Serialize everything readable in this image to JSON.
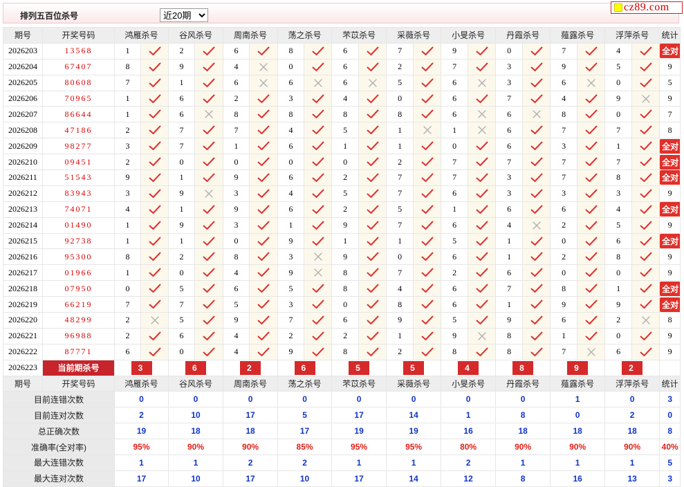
{
  "title": "排列五百位杀号",
  "period_select": {
    "value": "近20期",
    "options": [
      "近20期"
    ]
  },
  "logo": "cz89.com",
  "headers": [
    "期号",
    "开奖号码",
    "鸿雁杀号",
    "谷风杀号",
    "周南杀号",
    "荡之杀号",
    "芣苡杀号",
    "采薇杀号",
    "小旻杀号",
    "丹霞杀号",
    "薤露杀号",
    "浮萍杀号",
    "统计"
  ],
  "rows": [
    {
      "issue": "2026203",
      "draw": "13568",
      "kills": [
        [
          1,
          1
        ],
        [
          2,
          1
        ],
        [
          6,
          1
        ],
        [
          8,
          1
        ],
        [
          6,
          1
        ],
        [
          7,
          1
        ],
        [
          9,
          1
        ],
        [
          0,
          1
        ],
        [
          7,
          1
        ],
        [
          4,
          1
        ]
      ],
      "stat": "全对"
    },
    {
      "issue": "2026204",
      "draw": "67407",
      "kills": [
        [
          8,
          1
        ],
        [
          9,
          1
        ],
        [
          4,
          0
        ],
        [
          0,
          1
        ],
        [
          6,
          1
        ],
        [
          2,
          1
        ],
        [
          7,
          1
        ],
        [
          3,
          1
        ],
        [
          9,
          1
        ],
        [
          5,
          1
        ]
      ],
      "stat": "9"
    },
    {
      "issue": "2026205",
      "draw": "80608",
      "kills": [
        [
          7,
          1
        ],
        [
          1,
          1
        ],
        [
          6,
          0
        ],
        [
          6,
          0
        ],
        [
          6,
          0
        ],
        [
          5,
          1
        ],
        [
          6,
          0
        ],
        [
          3,
          1
        ],
        [
          6,
          0
        ],
        [
          0,
          1
        ]
      ],
      "stat": "5"
    },
    {
      "issue": "2026206",
      "draw": "70965",
      "kills": [
        [
          1,
          1
        ],
        [
          6,
          1
        ],
        [
          2,
          1
        ],
        [
          3,
          1
        ],
        [
          4,
          1
        ],
        [
          0,
          1
        ],
        [
          6,
          1
        ],
        [
          7,
          1
        ],
        [
          4,
          1
        ],
        [
          9,
          0
        ]
      ],
      "stat": "9"
    },
    {
      "issue": "2026207",
      "draw": "86644",
      "kills": [
        [
          1,
          1
        ],
        [
          6,
          0
        ],
        [
          8,
          1
        ],
        [
          8,
          1
        ],
        [
          8,
          1
        ],
        [
          8,
          1
        ],
        [
          6,
          0
        ],
        [
          6,
          0
        ],
        [
          8,
          1
        ],
        [
          0,
          1
        ]
      ],
      "stat": "7"
    },
    {
      "issue": "2026208",
      "draw": "47186",
      "kills": [
        [
          2,
          1
        ],
        [
          7,
          1
        ],
        [
          7,
          1
        ],
        [
          4,
          1
        ],
        [
          5,
          1
        ],
        [
          1,
          0
        ],
        [
          1,
          0
        ],
        [
          6,
          1
        ],
        [
          7,
          1
        ],
        [
          7,
          1
        ]
      ],
      "stat": "8"
    },
    {
      "issue": "2026209",
      "draw": "98277",
      "kills": [
        [
          3,
          1
        ],
        [
          7,
          1
        ],
        [
          1,
          1
        ],
        [
          6,
          1
        ],
        [
          1,
          1
        ],
        [
          1,
          1
        ],
        [
          0,
          1
        ],
        [
          6,
          1
        ],
        [
          3,
          1
        ],
        [
          1,
          1
        ]
      ],
      "stat": "全对"
    },
    {
      "issue": "2026210",
      "draw": "09451",
      "kills": [
        [
          2,
          1
        ],
        [
          0,
          1
        ],
        [
          0,
          1
        ],
        [
          0,
          1
        ],
        [
          0,
          1
        ],
        [
          2,
          1
        ],
        [
          7,
          1
        ],
        [
          7,
          1
        ],
        [
          7,
          1
        ],
        [
          7,
          1
        ]
      ],
      "stat": "全对"
    },
    {
      "issue": "2026211",
      "draw": "51543",
      "kills": [
        [
          9,
          1
        ],
        [
          1,
          1
        ],
        [
          9,
          1
        ],
        [
          6,
          1
        ],
        [
          2,
          1
        ],
        [
          7,
          1
        ],
        [
          7,
          1
        ],
        [
          3,
          1
        ],
        [
          7,
          1
        ],
        [
          8,
          1
        ]
      ],
      "stat": "全对"
    },
    {
      "issue": "2026212",
      "draw": "83943",
      "kills": [
        [
          3,
          1
        ],
        [
          9,
          0
        ],
        [
          3,
          1
        ],
        [
          4,
          1
        ],
        [
          5,
          1
        ],
        [
          7,
          1
        ],
        [
          6,
          1
        ],
        [
          3,
          1
        ],
        [
          3,
          1
        ],
        [
          3,
          1
        ]
      ],
      "stat": "9"
    },
    {
      "issue": "2026213",
      "draw": "74071",
      "kills": [
        [
          4,
          1
        ],
        [
          1,
          1
        ],
        [
          9,
          1
        ],
        [
          6,
          1
        ],
        [
          2,
          1
        ],
        [
          5,
          1
        ],
        [
          1,
          1
        ],
        [
          6,
          1
        ],
        [
          6,
          1
        ],
        [
          4,
          1
        ]
      ],
      "stat": "全对"
    },
    {
      "issue": "2026214",
      "draw": "01490",
      "kills": [
        [
          1,
          1
        ],
        [
          9,
          1
        ],
        [
          3,
          1
        ],
        [
          1,
          1
        ],
        [
          9,
          1
        ],
        [
          7,
          1
        ],
        [
          6,
          1
        ],
        [
          4,
          0
        ],
        [
          2,
          1
        ],
        [
          5,
          1
        ]
      ],
      "stat": "9"
    },
    {
      "issue": "2026215",
      "draw": "92738",
      "kills": [
        [
          1,
          1
        ],
        [
          1,
          1
        ],
        [
          0,
          1
        ],
        [
          9,
          1
        ],
        [
          1,
          1
        ],
        [
          1,
          1
        ],
        [
          5,
          1
        ],
        [
          1,
          1
        ],
        [
          0,
          1
        ],
        [
          6,
          1
        ]
      ],
      "stat": "全对"
    },
    {
      "issue": "2026216",
      "draw": "95300",
      "kills": [
        [
          8,
          1
        ],
        [
          2,
          1
        ],
        [
          8,
          1
        ],
        [
          3,
          0
        ],
        [
          9,
          1
        ],
        [
          0,
          1
        ],
        [
          6,
          1
        ],
        [
          1,
          1
        ],
        [
          2,
          1
        ],
        [
          8,
          1
        ]
      ],
      "stat": "9"
    },
    {
      "issue": "2026217",
      "draw": "01966",
      "kills": [
        [
          1,
          1
        ],
        [
          0,
          1
        ],
        [
          4,
          1
        ],
        [
          9,
          0
        ],
        [
          8,
          1
        ],
        [
          7,
          1
        ],
        [
          2,
          1
        ],
        [
          6,
          1
        ],
        [
          0,
          1
        ],
        [
          0,
          1
        ]
      ],
      "stat": "9"
    },
    {
      "issue": "2026218",
      "draw": "07950",
      "kills": [
        [
          0,
          1
        ],
        [
          5,
          1
        ],
        [
          6,
          1
        ],
        [
          5,
          1
        ],
        [
          8,
          1
        ],
        [
          4,
          1
        ],
        [
          6,
          1
        ],
        [
          7,
          1
        ],
        [
          8,
          1
        ],
        [
          1,
          1
        ]
      ],
      "stat": "全对"
    },
    {
      "issue": "2026219",
      "draw": "66219",
      "kills": [
        [
          7,
          1
        ],
        [
          7,
          1
        ],
        [
          5,
          1
        ],
        [
          3,
          1
        ],
        [
          0,
          1
        ],
        [
          8,
          1
        ],
        [
          6,
          1
        ],
        [
          1,
          1
        ],
        [
          9,
          1
        ],
        [
          9,
          1
        ]
      ],
      "stat": "全对"
    },
    {
      "issue": "2026220",
      "draw": "48299",
      "kills": [
        [
          2,
          0
        ],
        [
          5,
          1
        ],
        [
          9,
          1
        ],
        [
          7,
          1
        ],
        [
          6,
          1
        ],
        [
          9,
          1
        ],
        [
          5,
          1
        ],
        [
          9,
          1
        ],
        [
          6,
          1
        ],
        [
          2,
          0
        ]
      ],
      "stat": "8"
    },
    {
      "issue": "2026221",
      "draw": "96988",
      "kills": [
        [
          2,
          1
        ],
        [
          6,
          1
        ],
        [
          4,
          1
        ],
        [
          2,
          1
        ],
        [
          2,
          1
        ],
        [
          1,
          1
        ],
        [
          9,
          0
        ],
        [
          8,
          1
        ],
        [
          1,
          1
        ],
        [
          0,
          1
        ]
      ],
      "stat": "9"
    },
    {
      "issue": "2026222",
      "draw": "87771",
      "kills": [
        [
          6,
          1
        ],
        [
          0,
          1
        ],
        [
          4,
          1
        ],
        [
          9,
          1
        ],
        [
          8,
          1
        ],
        [
          2,
          1
        ],
        [
          8,
          1
        ],
        [
          8,
          1
        ],
        [
          7,
          0
        ],
        [
          6,
          1
        ]
      ],
      "stat": "9"
    }
  ],
  "current": {
    "issue": "2026223",
    "label": "当前期杀号",
    "kills": [
      "3",
      "6",
      "2",
      "6",
      "5",
      "5",
      "4",
      "8",
      "9",
      "2"
    ]
  },
  "summary": [
    {
      "label": "目前连错次数",
      "values": [
        "0",
        "0",
        "0",
        "0",
        "0",
        "0",
        "0",
        "0",
        "1",
        "0",
        "3"
      ]
    },
    {
      "label": "目前连对次数",
      "values": [
        "2",
        "10",
        "17",
        "5",
        "17",
        "14",
        "1",
        "8",
        "0",
        "2",
        "0"
      ]
    },
    {
      "label": "总正确次数",
      "values": [
        "19",
        "18",
        "18",
        "17",
        "19",
        "19",
        "16",
        "18",
        "18",
        "18",
        "8"
      ]
    },
    {
      "label": "准确率(全对率)",
      "values": [
        "95%",
        "90%",
        "90%",
        "85%",
        "95%",
        "95%",
        "80%",
        "90%",
        "90%",
        "90%",
        "40%"
      ],
      "pct": true
    },
    {
      "label": "最大连错次数",
      "values": [
        "1",
        "1",
        "2",
        "2",
        "1",
        "1",
        "2",
        "1",
        "1",
        "1",
        "5"
      ]
    },
    {
      "label": "最大连对次数",
      "values": [
        "17",
        "10",
        "17",
        "10",
        "17",
        "14",
        "12",
        "8",
        "16",
        "13",
        "3"
      ]
    }
  ],
  "colors": {
    "hit": "#e03030",
    "miss": "#b0b0b0",
    "accent": "#d62a2a",
    "value": "#1034c8",
    "highlight_bg": "#fcf9ec"
  },
  "icons": {
    "hit": "check-mark-icon",
    "miss": "cross-mark-icon"
  }
}
